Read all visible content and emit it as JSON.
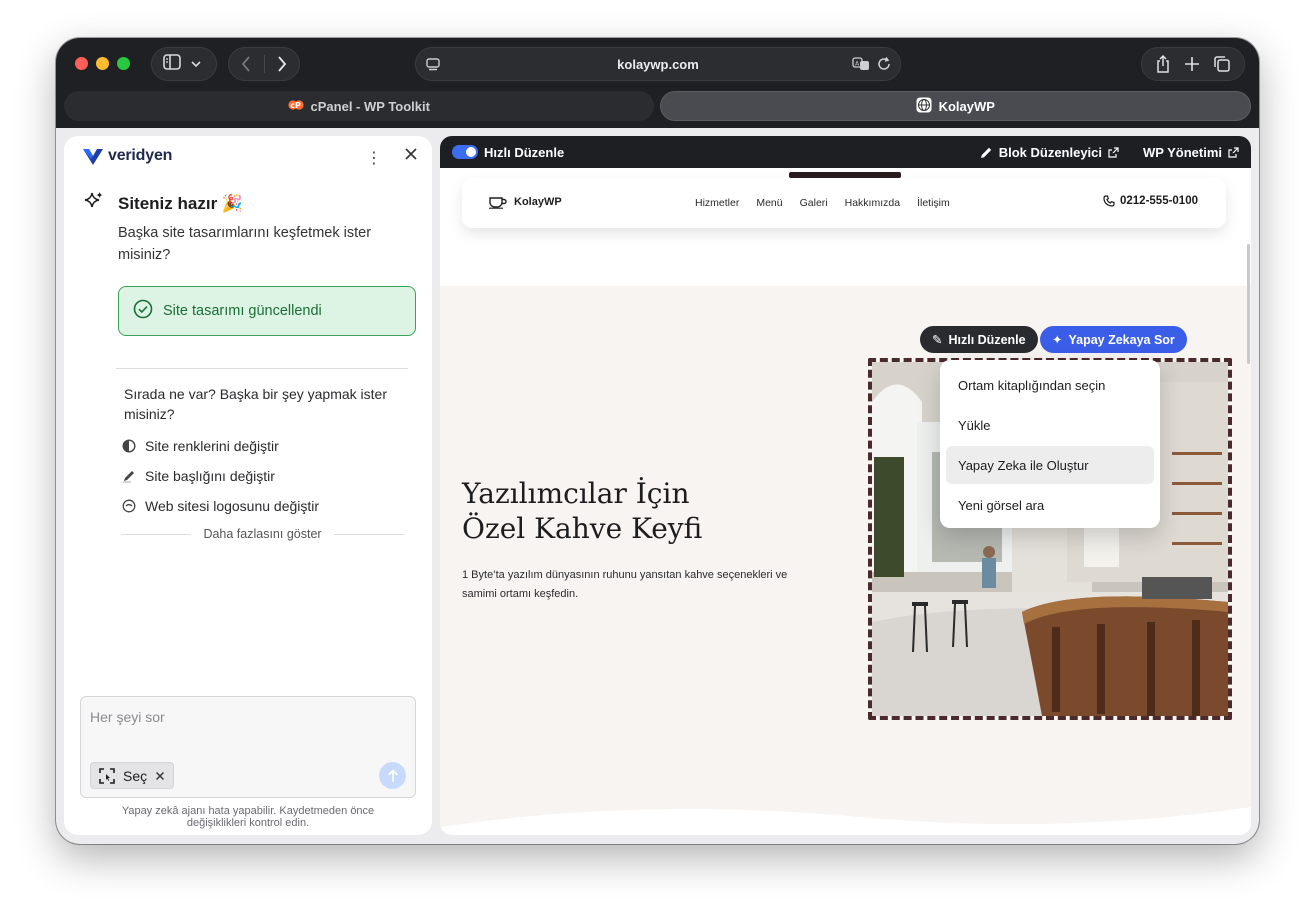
{
  "browser": {
    "url": "kolaywp.com",
    "tabs": [
      {
        "label": "cPanel - WP Toolkit",
        "active": false
      },
      {
        "label": "KolayWP",
        "active": true
      }
    ]
  },
  "assistant": {
    "brand": "veridyen",
    "title": "Siteniz hazır 🎉",
    "subtitle": "Başka site tasarımlarını keşfetmek ister misiniz?",
    "success_message": "Site tasarımı güncellendi",
    "next_question": "Sırada ne var? Başka bir şey yapmak ister misiniz?",
    "suggestions": [
      {
        "label": "Site renklerini değiştir",
        "icon": "contrast-icon"
      },
      {
        "label": "Site başlığını değiştir",
        "icon": "pencil-icon"
      },
      {
        "label": "Web sitesi logosunu değiştir",
        "icon": "logo-icon"
      }
    ],
    "show_more": "Daha fazlasını göster",
    "input_placeholder": "Her şeyi sor",
    "select_chip": "Seç",
    "disclaimer": "Yapay zekâ ajanı hata yapabilir. Kaydetmeden önce değişiklikleri kontrol edin."
  },
  "editor": {
    "quick_edit_toggle": "Hızlı Düzenle",
    "block_editor": "Blok Düzenleyici",
    "wp_admin": "WP Yönetimi"
  },
  "site": {
    "brand": "KolayWP",
    "menu": [
      "Hizmetler",
      "Menü",
      "Galeri",
      "Hakkımızda",
      "İletişim"
    ],
    "phone": "0212-555-0100",
    "hero_title_line1": "Yazılımcılar İçin",
    "hero_title_line2": "Özel Kahve Keyfi",
    "hero_text": "1 Byte’ta yazılım dünyasının ruhunu yansıtan kahve seçenekleri ve samimi ortamı keşfedin.",
    "image_toolbar": {
      "quick_edit": "Hızlı Düzenle",
      "ask_ai": "Yapay Zekaya Sor"
    },
    "image_menu": [
      "Ortam kitaplığından seçin",
      "Yükle",
      "Yapay Zeka ile Oluştur",
      "Yeni görsel ara"
    ]
  },
  "colors": {
    "accent_blue": "#3b5ee8",
    "success_green": "#3aa35b",
    "image_frame": "#4a2a2c"
  }
}
